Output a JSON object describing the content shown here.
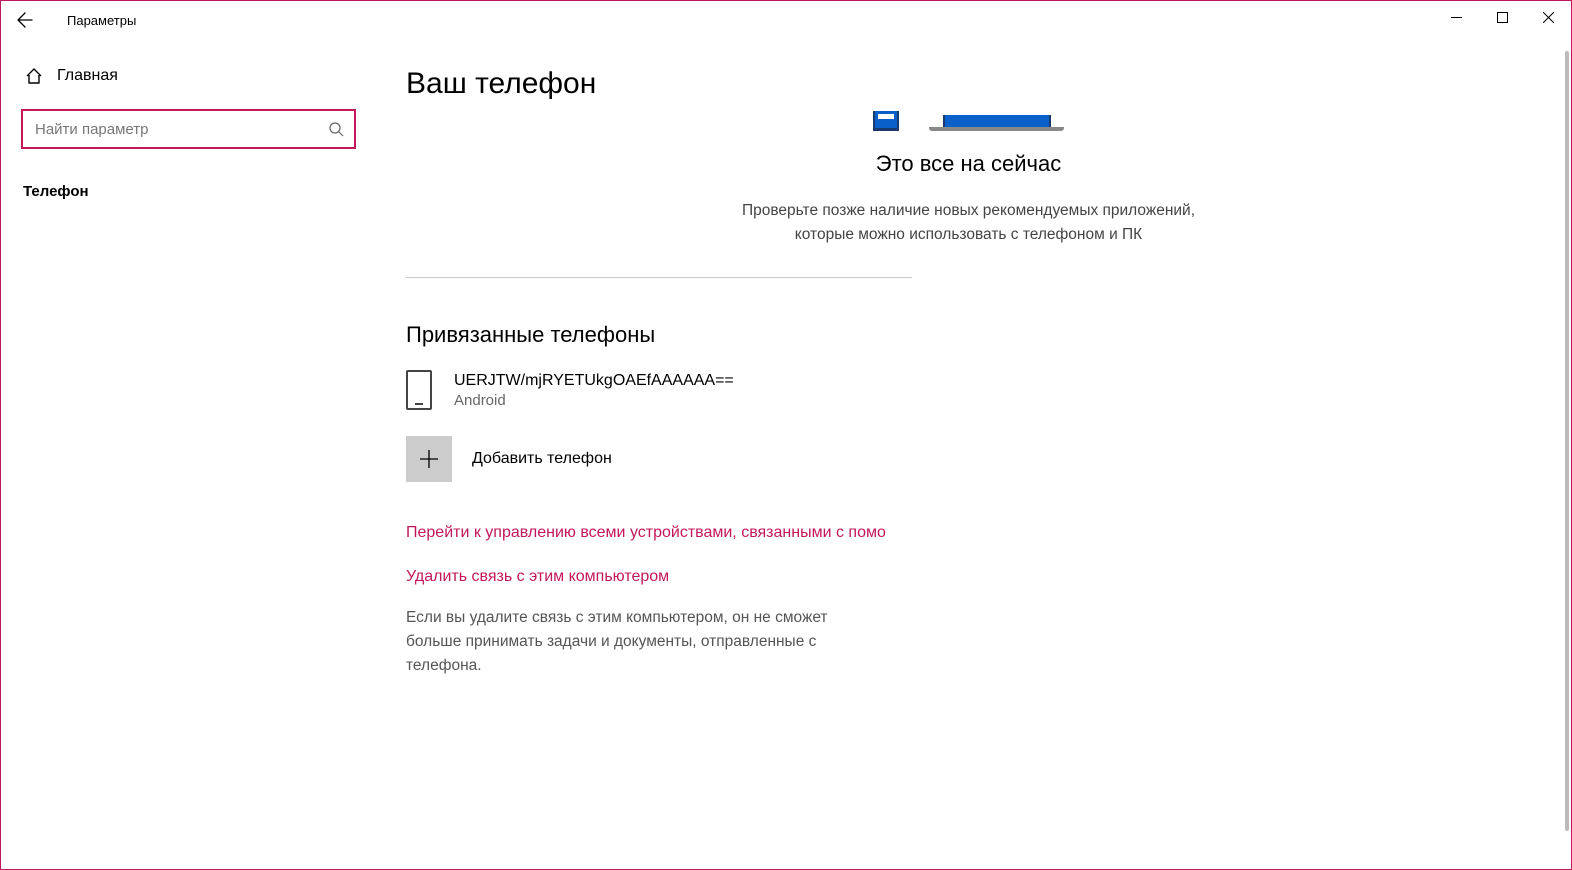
{
  "window": {
    "title": "Параметры"
  },
  "sidebar": {
    "home_label": "Главная",
    "search_placeholder": "Найти параметр",
    "nav_phone": "Телефон"
  },
  "main": {
    "page_title": "Ваш телефон",
    "hero_title": "Это все на сейчас",
    "hero_desc": "Проверьте позже наличие новых рекомендуемых приложений, которые можно использовать с телефоном и ПК",
    "linked_title": "Привязанные телефоны",
    "phone": {
      "name": "UERJTW/mjRYETUkgOAEfAAAAAA==",
      "platform": "Android"
    },
    "add_phone_label": "Добавить телефон",
    "manage_link": "Перейти к управлению всеми устройствами, связанными с помо",
    "unlink_link": "Удалить связь с этим компьютером",
    "unlink_desc": "Если вы удалите связь с этим компьютером, он не сможет больше принимать задачи и документы, отправленные с телефона."
  },
  "colors": {
    "accent": "#c2185b"
  }
}
